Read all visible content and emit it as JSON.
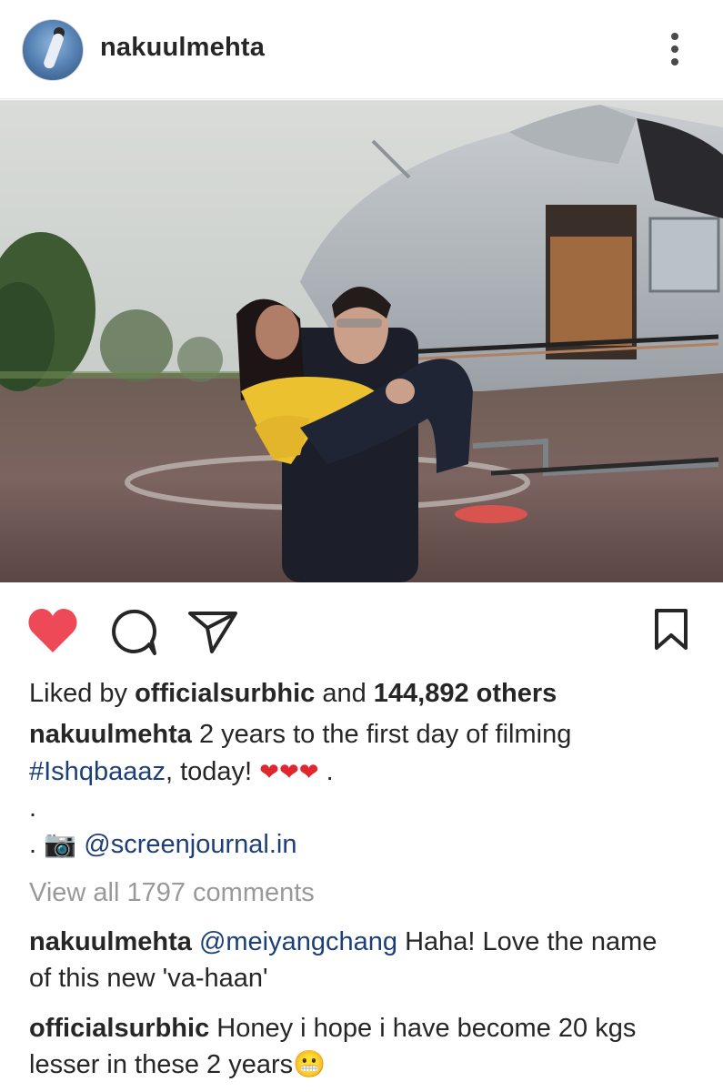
{
  "post": {
    "username": "nakuulmehta"
  },
  "likes": {
    "prefix": "Liked by",
    "liker": "officialsurbhic",
    "joiner": "and",
    "count_text": "144,892 others"
  },
  "caption": {
    "author": "nakuulmehta",
    "line1": "2 years to the first day of filming",
    "hashtag": "#Ishqbaaaz",
    "line2_rest": ", today!",
    "hearts": [
      "❤",
      "❤",
      "❤"
    ],
    "line2_tail": ".",
    "line3": ".",
    "line4_dot": ".",
    "camera_emoji": "📷",
    "credit": "@screenjournal.in"
  },
  "comments": {
    "view_all": "View all 1797 comments",
    "items": [
      {
        "author": "nakuulmehta",
        "mention": "@meiyangchang",
        "text_line1": "Haha! Love the name",
        "text_line2": "of this new 'va-haan'"
      },
      {
        "author": "officialsurbhic",
        "text_line1": "Honey i hope i have become 20 kgs",
        "text_line2": "lesser in these 2 years",
        "emoji": "😬"
      }
    ]
  },
  "icons": {
    "like": "heart-icon",
    "comment": "comment-icon",
    "share": "send-icon",
    "save": "bookmark-icon",
    "more": "more-vertical-icon"
  },
  "colors": {
    "like_red": "#ed4956",
    "link_blue": "#1c3f78",
    "muted_gray": "#999999"
  }
}
